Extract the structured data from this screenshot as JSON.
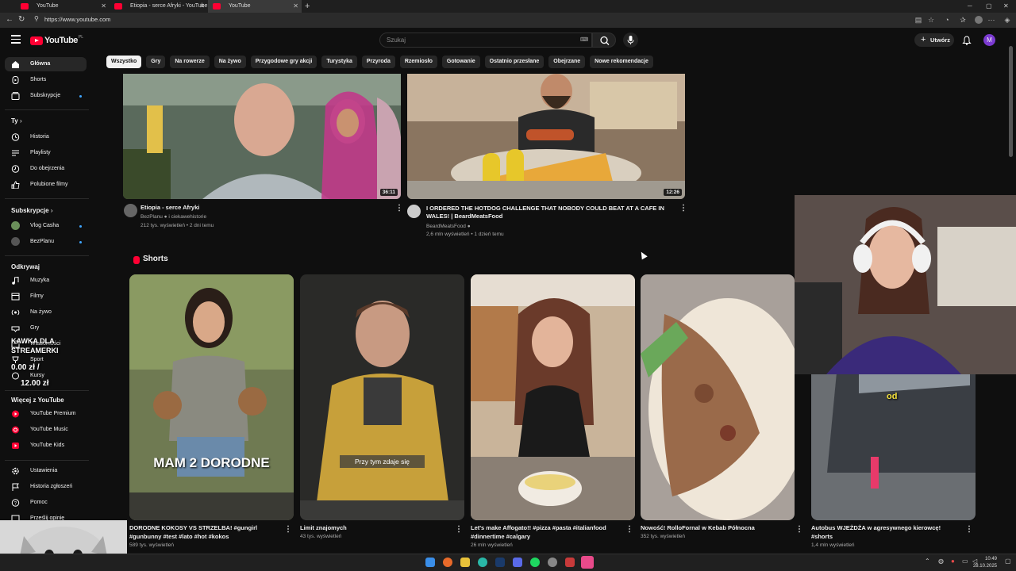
{
  "browser": {
    "tabs": [
      {
        "label": "YouTube",
        "active": false
      },
      {
        "label": "Etiopia - serce Afryki - YouTube",
        "active": false
      },
      {
        "label": "YouTube",
        "active": true
      }
    ],
    "url": "https://www.youtube.com"
  },
  "header": {
    "logo_text": "YouTube",
    "country_code": "PL",
    "search_placeholder": "Szukaj",
    "create_label": "Utwórz",
    "avatar_letter": "M"
  },
  "chips": [
    "Wszystko",
    "Gry",
    "Na rowerze",
    "Na żywo",
    "Przygodowe gry akcji",
    "Turystyka",
    "Przyroda",
    "Rzemiosło",
    "Gotowanie",
    "Ostatnio przesłane",
    "Obejrzane",
    "Nowe rekomendacje"
  ],
  "sidebar": {
    "main": [
      {
        "label": "Główna",
        "icon": "home-icon"
      },
      {
        "label": "Shorts",
        "icon": "shorts-icon"
      },
      {
        "label": "Subskrypcje",
        "icon": "subscriptions-icon"
      }
    ],
    "you_header": "Ty",
    "you": [
      {
        "label": "Historia",
        "icon": "history-icon"
      },
      {
        "label": "Playlisty",
        "icon": "playlist-icon"
      },
      {
        "label": "Do obejrzenia",
        "icon": "watch-later-icon"
      },
      {
        "label": "Polubione filmy",
        "icon": "like-icon"
      }
    ],
    "subs_header": "Subskrypcje",
    "subs": [
      {
        "label": "Vlog Casha"
      },
      {
        "label": "BezPlanu"
      }
    ],
    "explore_header": "Odkrywaj",
    "explore": [
      {
        "label": "Muzyka",
        "icon": "music-icon"
      },
      {
        "label": "Filmy",
        "icon": "film-icon"
      },
      {
        "label": "Na żywo",
        "icon": "live-icon"
      },
      {
        "label": "Gry",
        "icon": "gaming-icon"
      },
      {
        "label": "Wiadomości",
        "icon": "news-icon"
      },
      {
        "label": "Sport",
        "icon": "sport-icon"
      },
      {
        "label": "Kursy",
        "icon": "course-icon"
      }
    ],
    "more_header": "Więcej z YouTube",
    "more": [
      {
        "label": "YouTube Premium"
      },
      {
        "label": "YouTube Music"
      },
      {
        "label": "YouTube Kids"
      }
    ],
    "settings": [
      {
        "label": "Ustawienia",
        "icon": "gear-icon"
      },
      {
        "label": "Historia zgłoszeń",
        "icon": "flag-icon"
      },
      {
        "label": "Pomoc",
        "icon": "help-icon"
      },
      {
        "label": "Prześlij opinię",
        "icon": "feedback-icon"
      }
    ]
  },
  "videos": [
    {
      "title": "Etiopia - serce Afryki",
      "channel": "BezPlanu",
      "extra_channel": "i ciekawehistorie",
      "meta": "212 tys. wyświetleń • 2 dni temu",
      "duration": "36:11"
    },
    {
      "title": "I ORDERED THE HOTDOG CHALLENGE THAT NOBODY COULD BEAT AT A CAFE IN WALES! | BeardMeatsFood",
      "channel": "BeardMeatsFood",
      "meta": "2,6 mln wyświetleń • 1 dzień temu",
      "duration": "12:26"
    }
  ],
  "shorts_header": "Shorts",
  "shorts": [
    {
      "title": "DORODNE KOKOSY VS STRZELBA! #gungirl #gunbunny #test #lato #hot #kokos",
      "views": "589 tys. wyświetleń",
      "caption": "MAM 2 DORODNE"
    },
    {
      "title": "Limit znajomych",
      "views": "43 tys. wyświetleń",
      "caption": "Przy tym zdaje się"
    },
    {
      "title": "Let's make Affogato!! #pizza #pasta #italianfood #dinnertime #calgary",
      "views": "26 mln wyświetleń",
      "caption": ""
    },
    {
      "title": "Nowość! RolloFornal w Kebab Północna",
      "views": "352 tys. wyświetleń",
      "caption": ""
    },
    {
      "title": "Autobus WJEŻDŻA w agresywnego kierowcę! #shorts",
      "views": "1,4 mln wyświetleń",
      "caption": "od"
    }
  ],
  "overlay": {
    "donation_title": "KAWKA DLA STREAMERKI",
    "donation_current": "0.00 zł",
    "donation_separator": "/",
    "donation_goal": "12.00 zł"
  },
  "taskbar": {
    "time": "10:49",
    "date": "28.10.2025"
  },
  "colors": {
    "brand": "#ff0033",
    "background": "#0f0f0f",
    "chip_bg": "#272727",
    "accent": "#3ea6ff"
  }
}
